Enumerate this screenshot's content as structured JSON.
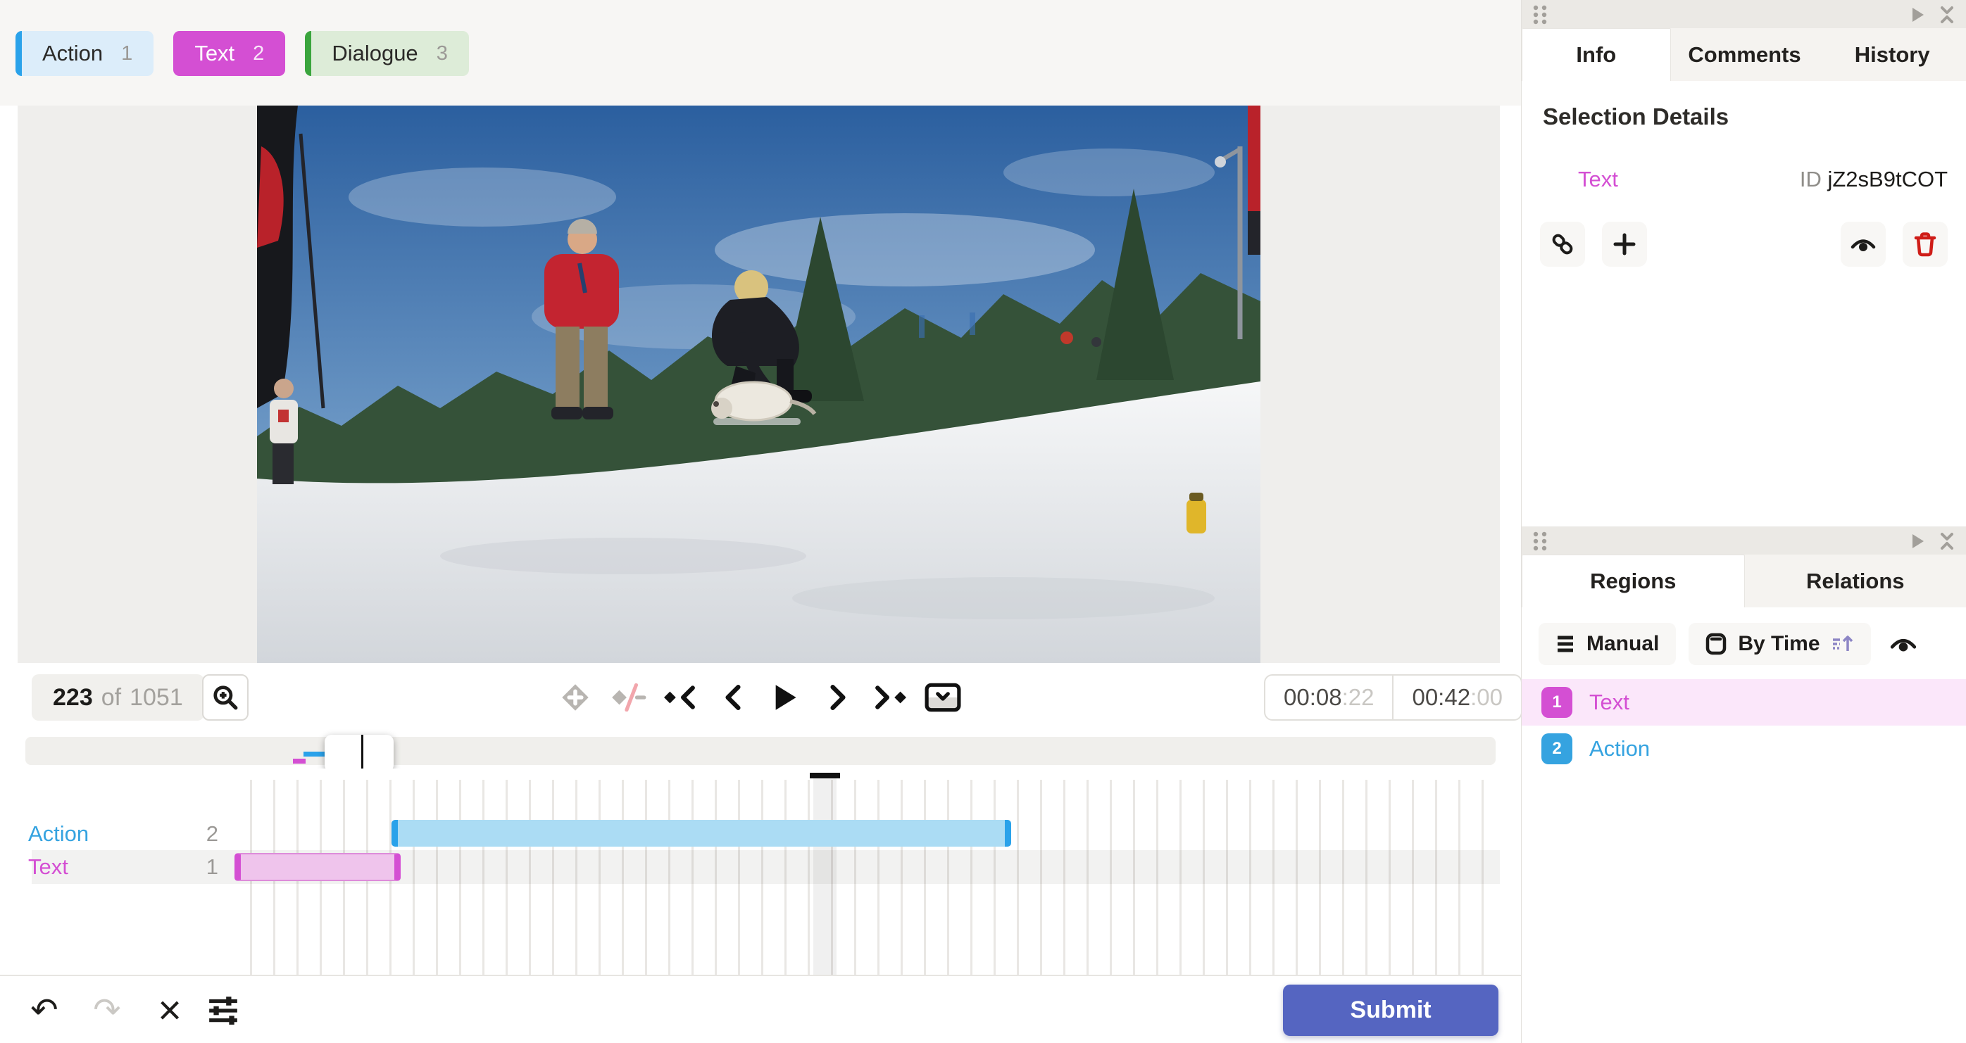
{
  "header_labels": {
    "items": [
      {
        "name": "Action",
        "hotkey": "1",
        "color": "#2aa2ea",
        "selected": false
      },
      {
        "name": "Text",
        "hotkey": "2",
        "color": "#d44fd3",
        "selected": true
      },
      {
        "name": "Dialogue",
        "hotkey": "3",
        "color": "#3aa53d",
        "selected": false
      }
    ]
  },
  "player": {
    "frame_current": "223",
    "frame_separator": "of",
    "frame_total": "1051",
    "time_position": "00:08",
    "time_position_frames": ":22",
    "time_duration": "00:42",
    "time_duration_frames": ":00"
  },
  "info_panel": {
    "tabs": {
      "info": "Info",
      "comments": "Comments",
      "history": "History"
    },
    "heading": "Selection Details",
    "selection": {
      "type": "Text",
      "id_label": "ID",
      "id_value": "jZ2sB9tCOT"
    }
  },
  "regions_panel": {
    "tabs": {
      "regions": "Regions",
      "relations": "Relations"
    },
    "toolbar": {
      "manual": "Manual",
      "by_time": "By Time"
    },
    "items": [
      {
        "index": "1",
        "label": "Text",
        "selected": true
      },
      {
        "index": "2",
        "label": "Action",
        "selected": false
      }
    ]
  },
  "timeline": {
    "tracks": [
      {
        "label": "Action",
        "count": "2",
        "color": "#35a3e0"
      },
      {
        "label": "Text",
        "count": "1",
        "color": "#d44fd3"
      }
    ]
  },
  "footer": {
    "submit": "Submit"
  },
  "colors": {
    "accent_blue": "#2aa2ea",
    "accent_magenta": "#d44fd3",
    "accent_green": "#3aa53d",
    "submit_indigo": "#5565c1",
    "danger_red": "#cf1d18"
  }
}
